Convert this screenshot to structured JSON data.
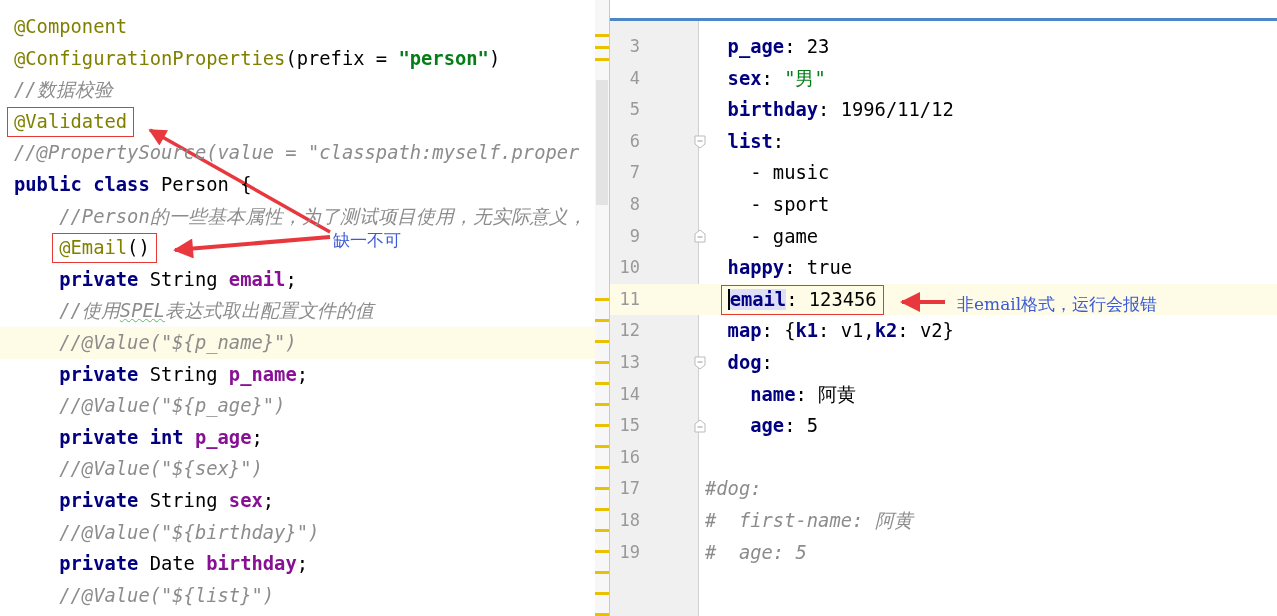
{
  "java_editor": {
    "lines": [
      {
        "tokens": [
          {
            "kind": "ann",
            "text": "@Component"
          }
        ]
      },
      {
        "tokens": [
          {
            "kind": "ann",
            "text": "@ConfigurationProperties"
          },
          {
            "kind": "plain",
            "text": "(prefix = "
          },
          {
            "kind": "str",
            "text": "\"person\""
          },
          {
            "kind": "plain",
            "text": ")"
          }
        ]
      },
      {
        "tokens": [
          {
            "kind": "cmt",
            "text": "//数据校验"
          }
        ]
      },
      {
        "boxed": true,
        "tokens": [
          {
            "kind": "ann",
            "text": "@Validated"
          }
        ]
      },
      {
        "tokens": [
          {
            "kind": "cmt",
            "text": "//@PropertySource(value = \"classpath:myself.proper"
          }
        ]
      },
      {
        "tokens": [
          {
            "kind": "kw",
            "text": "public class "
          },
          {
            "kind": "plain",
            "text": "Person {"
          }
        ]
      },
      {
        "tokens": [
          {
            "kind": "cmt",
            "text": "    //Person的一些基本属性，为了测试项目使用，无实际意义，"
          }
        ]
      },
      {
        "boxed": true,
        "tokens": [
          {
            "kind": "ann",
            "text": "    @Email"
          },
          {
            "kind": "plain",
            "text": "()"
          }
        ]
      },
      {
        "tokens": [
          {
            "kind": "kw",
            "text": "    private "
          },
          {
            "kind": "plain",
            "text": "String "
          },
          {
            "kind": "field",
            "text": "email"
          },
          {
            "kind": "plain",
            "text": ";"
          }
        ]
      },
      {
        "tokens": [
          {
            "kind": "cmt",
            "text": "    //使用"
          },
          {
            "kind": "cmt",
            "text": "SPEL",
            "typo": true
          },
          {
            "kind": "cmt",
            "text": "表达式取出配置文件的值"
          }
        ]
      },
      {
        "current": true,
        "tokens": [
          {
            "kind": "cmt",
            "text": "    //@Value(\"${p_name}\")"
          }
        ]
      },
      {
        "tokens": [
          {
            "kind": "kw",
            "text": "    private "
          },
          {
            "kind": "plain",
            "text": "String "
          },
          {
            "kind": "field",
            "text": "p_name"
          },
          {
            "kind": "plain",
            "text": ";"
          }
        ]
      },
      {
        "tokens": [
          {
            "kind": "cmt",
            "text": "    //@Value(\"${p_age}\")"
          }
        ]
      },
      {
        "tokens": [
          {
            "kind": "kw",
            "text": "    private int "
          },
          {
            "kind": "field",
            "text": "p_age"
          },
          {
            "kind": "plain",
            "text": ";"
          }
        ]
      },
      {
        "tokens": [
          {
            "kind": "cmt",
            "text": "    //@Value(\"${sex}\")"
          }
        ]
      },
      {
        "tokens": [
          {
            "kind": "kw",
            "text": "    private "
          },
          {
            "kind": "plain",
            "text": "String "
          },
          {
            "kind": "field",
            "text": "sex"
          },
          {
            "kind": "plain",
            "text": ";"
          }
        ]
      },
      {
        "tokens": [
          {
            "kind": "cmt",
            "text": "    //@Value(\"${birthday}\")"
          }
        ]
      },
      {
        "tokens": [
          {
            "kind": "kw",
            "text": "    private "
          },
          {
            "kind": "plain",
            "text": "Date "
          },
          {
            "kind": "field",
            "text": "birthday"
          },
          {
            "kind": "plain",
            "text": ";"
          }
        ]
      },
      {
        "tokens": [
          {
            "kind": "cmt",
            "text": "    //@Value(\"${list}\")"
          }
        ]
      }
    ]
  },
  "yaml_editor": {
    "lines": [
      {
        "number": "3",
        "tokens": [
          {
            "kind": "key",
            "text": "  p_age"
          },
          {
            "kind": "plain",
            "text": ": 23"
          }
        ]
      },
      {
        "number": "4",
        "tokens": [
          {
            "kind": "key",
            "text": "  sex"
          },
          {
            "kind": "plain",
            "text": ": "
          },
          {
            "kind": "ystr",
            "text": "\"男\""
          }
        ]
      },
      {
        "number": "5",
        "tokens": [
          {
            "kind": "key",
            "text": "  birthday"
          },
          {
            "kind": "plain",
            "text": ": 1996/11/12"
          }
        ]
      },
      {
        "number": "6",
        "fold_start": true,
        "tokens": [
          {
            "kind": "key",
            "text": "  list"
          },
          {
            "kind": "plain",
            "text": ":"
          }
        ]
      },
      {
        "number": "7",
        "tokens": [
          {
            "kind": "plain",
            "text": "    - music"
          }
        ]
      },
      {
        "number": "8",
        "tokens": [
          {
            "kind": "plain",
            "text": "    - sport"
          }
        ]
      },
      {
        "number": "9",
        "fold_end": true,
        "tokens": [
          {
            "kind": "plain",
            "text": "    - game"
          }
        ]
      },
      {
        "number": "10",
        "tokens": [
          {
            "kind": "key",
            "text": "  happy"
          },
          {
            "kind": "plain",
            "text": ": true"
          }
        ]
      },
      {
        "number": "11",
        "current": true,
        "boxed": true,
        "tokens": [
          {
            "kind": "key",
            "text": "  email",
            "caret": true,
            "highlighted": true
          },
          {
            "kind": "plain",
            "text": ": 123456"
          }
        ]
      },
      {
        "number": "12",
        "tokens": [
          {
            "kind": "key",
            "text": "  map"
          },
          {
            "kind": "plain",
            "text": ": {"
          },
          {
            "kind": "key",
            "text": "k1"
          },
          {
            "kind": "plain",
            "text": ": v1,"
          },
          {
            "kind": "key",
            "text": "k2"
          },
          {
            "kind": "plain",
            "text": ": v2}"
          }
        ]
      },
      {
        "number": "13",
        "fold_start": true,
        "tokens": [
          {
            "kind": "key",
            "text": "  dog"
          },
          {
            "kind": "plain",
            "text": ":"
          }
        ]
      },
      {
        "number": "14",
        "tokens": [
          {
            "kind": "key",
            "text": "    name"
          },
          {
            "kind": "plain",
            "text": ": 阿黄"
          }
        ]
      },
      {
        "number": "15",
        "fold_end": true,
        "tokens": [
          {
            "kind": "key",
            "text": "    age"
          },
          {
            "kind": "plain",
            "text": ": 5"
          }
        ]
      },
      {
        "number": "16"
      },
      {
        "number": "17",
        "tokens": [
          {
            "kind": "cmt",
            "text": "#dog:"
          }
        ]
      },
      {
        "number": "18",
        "tokens": [
          {
            "kind": "cmt",
            "text": "#  first-name: 阿黄"
          }
        ]
      },
      {
        "number": "19",
        "tokens": [
          {
            "kind": "cmt",
            "text": "#  age: 5"
          }
        ]
      }
    ]
  },
  "callouts": [
    {
      "text": "缺一不可"
    },
    {
      "text": "非email格式，运行会报错"
    }
  ]
}
